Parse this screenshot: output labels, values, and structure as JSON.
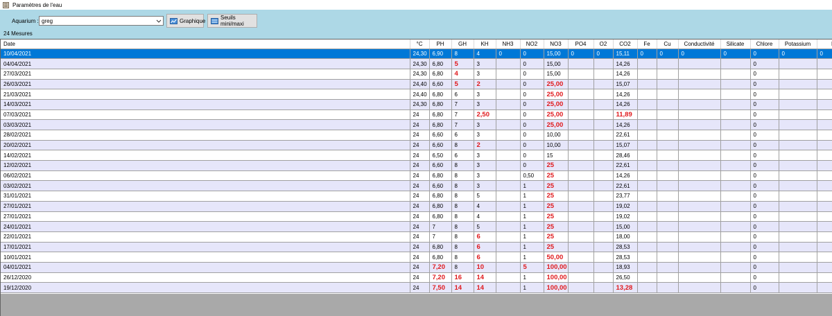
{
  "window": {
    "title": "Paramètres de l'eau"
  },
  "toolbar": {
    "aquarium_label": "Aquarium :",
    "aquarium_value": "greg",
    "graph_button": "Graphique",
    "thresholds_button": "Seuils mini/maxi",
    "count_text": "24 Mesures"
  },
  "colors": {
    "panel": "#add8e6",
    "selection": "#0078d7",
    "alt_row": "#e6e6fa",
    "alert": "#e0191c"
  },
  "columns": [
    "Date",
    "°C",
    "PH",
    "GH",
    "KH",
    "NH3",
    "NO2",
    "NO3",
    "PO4",
    "O2",
    "CO2",
    "Fe",
    "Cu",
    "Conductivité",
    "Silicate",
    "Chlore",
    "Potassium",
    "Ma"
  ],
  "rows": [
    {
      "selected": true,
      "cells": [
        "10/04/2021",
        "24,30",
        "6,90",
        "8",
        "4",
        "0",
        "0",
        "15,00",
        "0",
        "0",
        "15,11",
        "0",
        "0",
        "0",
        "0",
        "0",
        "0",
        "0"
      ],
      "alerts": []
    },
    {
      "cells": [
        "04/04/2021",
        "24,30",
        "6,80",
        "5",
        "3",
        "",
        "0",
        "15,00",
        "",
        "",
        "14,26",
        "",
        "",
        "",
        "",
        "0",
        "",
        ""
      ],
      "alerts": [
        3
      ]
    },
    {
      "cells": [
        "27/03/2021",
        "24,30",
        "6,80",
        "4",
        "3",
        "",
        "0",
        "15,00",
        "",
        "",
        "14,26",
        "",
        "",
        "",
        "",
        "0",
        "",
        ""
      ],
      "alerts": [
        3
      ]
    },
    {
      "cells": [
        "26/03/2021",
        "24,40",
        "6,60",
        "5",
        "2",
        "",
        "0",
        "25,00",
        "",
        "",
        "15,07",
        "",
        "",
        "",
        "",
        "0",
        "",
        ""
      ],
      "alerts": [
        3,
        4,
        7
      ]
    },
    {
      "cells": [
        "21/03/2021",
        "24,40",
        "6,80",
        "6",
        "3",
        "",
        "0",
        "25,00",
        "",
        "",
        "14,26",
        "",
        "",
        "",
        "",
        "0",
        "",
        ""
      ],
      "alerts": [
        7
      ]
    },
    {
      "cells": [
        "14/03/2021",
        "24,30",
        "6,80",
        "7",
        "3",
        "",
        "0",
        "25,00",
        "",
        "",
        "14,26",
        "",
        "",
        "",
        "",
        "0",
        "",
        ""
      ],
      "alerts": [
        7
      ]
    },
    {
      "cells": [
        "07/03/2021",
        "24",
        "6,80",
        "7",
        "2,50",
        "",
        "0",
        "25,00",
        "",
        "",
        "11,89",
        "",
        "",
        "",
        "",
        "0",
        "",
        ""
      ],
      "alerts": [
        4,
        7,
        10
      ]
    },
    {
      "cells": [
        "03/03/2021",
        "24",
        "6,80",
        "7",
        "3",
        "",
        "0",
        "25,00",
        "",
        "",
        "14,26",
        "",
        "",
        "",
        "",
        "0",
        "",
        ""
      ],
      "alerts": [
        7
      ]
    },
    {
      "cells": [
        "28/02/2021",
        "24",
        "6,60",
        "6",
        "3",
        "",
        "0",
        "10,00",
        "",
        "",
        "22,61",
        "",
        "",
        "",
        "",
        "0",
        "",
        ""
      ],
      "alerts": []
    },
    {
      "cells": [
        "20/02/2021",
        "24",
        "6,60",
        "8",
        "2",
        "",
        "0",
        "10,00",
        "",
        "",
        "15,07",
        "",
        "",
        "",
        "",
        "0",
        "",
        ""
      ],
      "alerts": [
        4
      ]
    },
    {
      "cells": [
        "14/02/2021",
        "24",
        "6,50",
        "6",
        "3",
        "",
        "0",
        "15",
        "",
        "",
        "28,46",
        "",
        "",
        "",
        "",
        "0",
        "",
        ""
      ],
      "alerts": []
    },
    {
      "cells": [
        "12/02/2021",
        "24",
        "6,60",
        "8",
        "3",
        "",
        "0",
        "25",
        "",
        "",
        "22,61",
        "",
        "",
        "",
        "",
        "0",
        "",
        ""
      ],
      "alerts": [
        7
      ]
    },
    {
      "cells": [
        "06/02/2021",
        "24",
        "6,80",
        "8",
        "3",
        "",
        "0,50",
        "25",
        "",
        "",
        "14,26",
        "",
        "",
        "",
        "",
        "0",
        "",
        ""
      ],
      "alerts": [
        7
      ]
    },
    {
      "cells": [
        "03/02/2021",
        "24",
        "6,60",
        "8",
        "3",
        "",
        "1",
        "25",
        "",
        "",
        "22,61",
        "",
        "",
        "",
        "",
        "0",
        "",
        ""
      ],
      "alerts": [
        7
      ]
    },
    {
      "cells": [
        "31/01/2021",
        "24",
        "6,80",
        "8",
        "5",
        "",
        "1",
        "25",
        "",
        "",
        "23,77",
        "",
        "",
        "",
        "",
        "0",
        "",
        ""
      ],
      "alerts": [
        7
      ]
    },
    {
      "cells": [
        "27/01/2021",
        "24",
        "6,80",
        "8",
        "4",
        "",
        "1",
        "25",
        "",
        "",
        "19,02",
        "",
        "",
        "",
        "",
        "0",
        "",
        ""
      ],
      "alerts": [
        7
      ]
    },
    {
      "cells": [
        "27/01/2021",
        "24",
        "6,80",
        "8",
        "4",
        "",
        "1",
        "25",
        "",
        "",
        "19,02",
        "",
        "",
        "",
        "",
        "0",
        "",
        ""
      ],
      "alerts": [
        7
      ]
    },
    {
      "cells": [
        "24/01/2021",
        "24",
        "7",
        "8",
        "5",
        "",
        "1",
        "25",
        "",
        "",
        "15,00",
        "",
        "",
        "",
        "",
        "0",
        "",
        ""
      ],
      "alerts": [
        7
      ]
    },
    {
      "cells": [
        "22/01/2021",
        "24",
        "7",
        "8",
        "6",
        "",
        "1",
        "25",
        "",
        "",
        "18,00",
        "",
        "",
        "",
        "",
        "0",
        "",
        ""
      ],
      "alerts": [
        4,
        7
      ]
    },
    {
      "cells": [
        "17/01/2021",
        "24",
        "6,80",
        "8",
        "6",
        "",
        "1",
        "25",
        "",
        "",
        "28,53",
        "",
        "",
        "",
        "",
        "0",
        "",
        ""
      ],
      "alerts": [
        4,
        7
      ]
    },
    {
      "cells": [
        "10/01/2021",
        "24",
        "6,80",
        "8",
        "6",
        "",
        "1",
        "50,00",
        "",
        "",
        "28,53",
        "",
        "",
        "",
        "",
        "0",
        "",
        ""
      ],
      "alerts": [
        4,
        7
      ]
    },
    {
      "cells": [
        "04/01/2021",
        "24",
        "7,20",
        "8",
        "10",
        "",
        "5",
        "100,00",
        "",
        "",
        "18,93",
        "",
        "",
        "",
        "",
        "0",
        "",
        ""
      ],
      "alerts": [
        2,
        4,
        6,
        7
      ]
    },
    {
      "cells": [
        "26/12/2020",
        "24",
        "7,20",
        "16",
        "14",
        "",
        "1",
        "100,00",
        "",
        "",
        "26,50",
        "",
        "",
        "",
        "",
        "0",
        "",
        ""
      ],
      "alerts": [
        2,
        3,
        4,
        7
      ]
    },
    {
      "cells": [
        "19/12/2020",
        "24",
        "7,50",
        "14",
        "14",
        "",
        "1",
        "100,00",
        "",
        "",
        "13,28",
        "",
        "",
        "",
        "",
        "0",
        "",
        ""
      ],
      "alerts": [
        2,
        3,
        4,
        7,
        10
      ]
    }
  ]
}
